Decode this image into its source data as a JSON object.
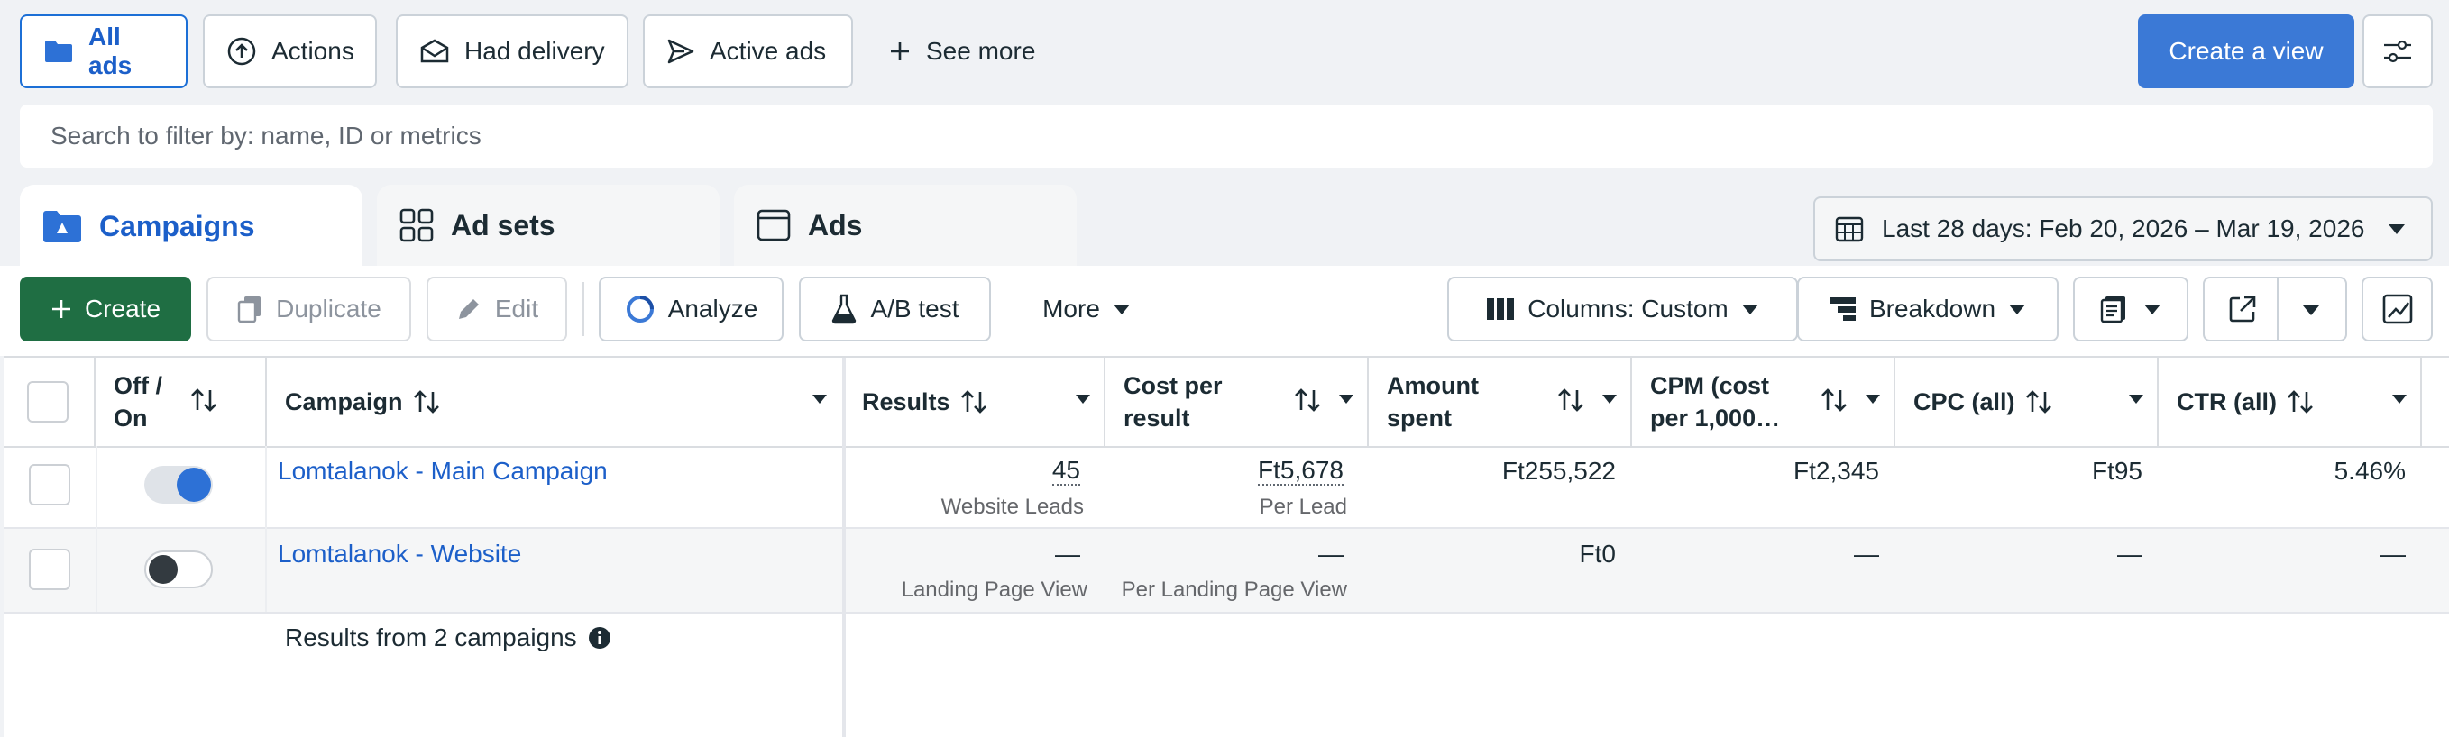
{
  "views": {
    "all_ads": "All ads",
    "actions": "Actions",
    "had_delivery": "Had delivery",
    "active_ads": "Active ads",
    "see_more": "See more",
    "create_view": "Create a view"
  },
  "search": {
    "placeholder": "Search to filter by: name, ID or metrics"
  },
  "tabs": {
    "campaigns": "Campaigns",
    "ad_sets": "Ad sets",
    "ads": "Ads"
  },
  "date_range": "Last 28 days: Feb 20, 2026 – Mar 19, 2026",
  "toolbar": {
    "create": "Create",
    "duplicate": "Duplicate",
    "edit": "Edit",
    "analyze": "Analyze",
    "ab_test": "A/B test",
    "more": "More",
    "columns": "Columns: Custom",
    "breakdown": "Breakdown"
  },
  "table": {
    "headers": {
      "off_on_1": "Off /",
      "off_on_2": "On",
      "campaign": "Campaign",
      "results": "Results",
      "cost_per_result_1": "Cost per",
      "cost_per_result_2": "result",
      "amount_spent_1": "Amount",
      "amount_spent_2": "spent",
      "cpm_1": "CPM (cost",
      "cpm_2": "per 1,000…",
      "cpc": "CPC (all)",
      "ctr": "CTR (all)"
    },
    "rows": [
      {
        "campaign": "Lomtalanok - Main Campaign",
        "active": true,
        "results": "45",
        "results_sub": "Website Leads",
        "cost_per_result": "Ft5,678",
        "cost_per_result_sub": "Per Lead",
        "amount_spent": "Ft255,522",
        "cpm": "Ft2,345",
        "cpc": "Ft95",
        "ctr": "5.46%"
      },
      {
        "campaign": "Lomtalanok - Website",
        "active": false,
        "results": "—",
        "results_sub": "Landing Page View",
        "cost_per_result": "—",
        "cost_per_result_sub": "Per Landing Page View",
        "amount_spent": "Ft0",
        "cpm": "—",
        "cpc": "—",
        "ctr": "—"
      }
    ],
    "summary": "Results from 2 campaigns"
  },
  "colors": {
    "accent": "#3b79d6",
    "link": "#1c5fc9",
    "create_green": "#1f6e43",
    "toggle_on": "#2d71d6",
    "background": "#f0f2f5"
  },
  "icons": [
    "folder-icon",
    "upload-circle-icon",
    "envelope-icon",
    "send-icon",
    "plus-icon",
    "sliders-icon",
    "grid-icon",
    "ad-frame-icon",
    "calendar-icon",
    "duplicate-icon",
    "pencil-icon",
    "analyze-ring-icon",
    "flask-icon",
    "columns-icon",
    "breakdown-icon",
    "reports-icon",
    "export-icon",
    "chart-icon",
    "info-icon",
    "sort-icon",
    "chevron-down-icon"
  ]
}
